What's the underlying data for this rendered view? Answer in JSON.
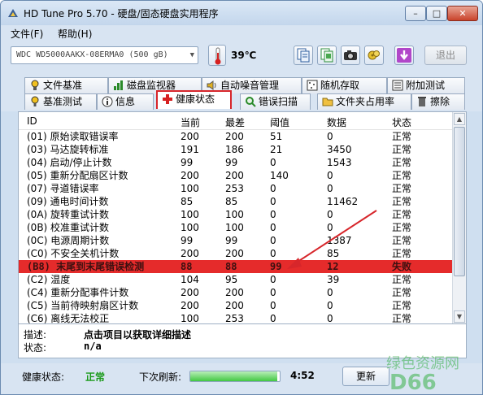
{
  "window": {
    "title": "HD Tune Pro 5.70 - 硬盘/固态硬盘实用程序",
    "minimize": "–",
    "maximize": "□",
    "close": "✕"
  },
  "menu": [
    {
      "label": "文件(F)"
    },
    {
      "label": "帮助(H)"
    }
  ],
  "toolbar": {
    "drive": "WDC WD5000AAKX-08ERMA0 (500 gB)",
    "temperature": "39℃",
    "exit_label": "退出",
    "buttons": [
      "copy-text-icon",
      "copy-screen-icon",
      "camera-icon",
      "settings-icon",
      "download-icon"
    ]
  },
  "tabs_top": [
    {
      "label": "文件基准"
    },
    {
      "label": "磁盘监视器"
    },
    {
      "label": "自动噪音管理"
    },
    {
      "label": "随机存取"
    },
    {
      "label": "附加测试"
    }
  ],
  "tabs_bottom": [
    {
      "label": "基准测试"
    },
    {
      "label": "信息"
    },
    {
      "label": "健康状态"
    },
    {
      "label": "错误扫描"
    },
    {
      "label": "文件夹占用率"
    },
    {
      "label": "擦除"
    }
  ],
  "table": {
    "headers": [
      "ID",
      "当前",
      "最差",
      "阈值",
      "数据",
      "状态"
    ],
    "rows": [
      {
        "id": "(01) 原始读取错误率",
        "cur": "200",
        "worst": "200",
        "thr": "51",
        "data": "0",
        "status": "正常"
      },
      {
        "id": "(03) 马达旋转标准",
        "cur": "191",
        "worst": "186",
        "thr": "21",
        "data": "3450",
        "status": "正常"
      },
      {
        "id": "(04) 启动/停止计数",
        "cur": "99",
        "worst": "99",
        "thr": "0",
        "data": "1543",
        "status": "正常"
      },
      {
        "id": "(05) 重新分配扇区计数",
        "cur": "200",
        "worst": "200",
        "thr": "140",
        "data": "0",
        "status": "正常"
      },
      {
        "id": "(07) 寻道错误率",
        "cur": "100",
        "worst": "253",
        "thr": "0",
        "data": "0",
        "status": "正常"
      },
      {
        "id": "(09) 通电时间计数",
        "cur": "85",
        "worst": "85",
        "thr": "0",
        "data": "11462",
        "status": "正常"
      },
      {
        "id": "(0A) 旋转重试计数",
        "cur": "100",
        "worst": "100",
        "thr": "0",
        "data": "0",
        "status": "正常"
      },
      {
        "id": "(0B) 校准重试计数",
        "cur": "100",
        "worst": "100",
        "thr": "0",
        "data": "0",
        "status": "正常"
      },
      {
        "id": "(0C) 电源周期计数",
        "cur": "99",
        "worst": "99",
        "thr": "0",
        "data": "1387",
        "status": "正常"
      },
      {
        "id": "(C0) 不安全关机计数",
        "cur": "200",
        "worst": "200",
        "thr": "0",
        "data": "85",
        "status": "正常"
      },
      {
        "id": "(B8) 末尾到末尾错误检测",
        "cur": "88",
        "worst": "88",
        "thr": "99",
        "data": "12",
        "status": "失败"
      },
      {
        "id": "(C2) 温度",
        "cur": "104",
        "worst": "95",
        "thr": "0",
        "data": "39",
        "status": "正常"
      },
      {
        "id": "(C4) 重新分配事件计数",
        "cur": "200",
        "worst": "200",
        "thr": "0",
        "data": "0",
        "status": "正常"
      },
      {
        "id": "(C5) 当前待映射扇区计数",
        "cur": "200",
        "worst": "200",
        "thr": "0",
        "data": "0",
        "status": "正常"
      },
      {
        "id": "(C6) 离线无法校正",
        "cur": "100",
        "worst": "253",
        "thr": "0",
        "data": "0",
        "status": "正常"
      }
    ]
  },
  "detail": {
    "desc_label": "描述:",
    "desc_value": "点击项目以获取详细描述",
    "status_label": "状态:",
    "status_value": "n/a"
  },
  "statusbar": {
    "health_label": "健康状态:",
    "health_value": "正常",
    "refresh_label": "下次刷新:",
    "countdown": "4:52",
    "refresh_button": "更新",
    "progress": 0.97
  },
  "watermark": "绿色资源网",
  "colors": {
    "alert_row": "#e52b2b",
    "health_ok": "#1a9a1a",
    "active_tab_border": "#d7262b",
    "arrow": "#d7262b"
  }
}
